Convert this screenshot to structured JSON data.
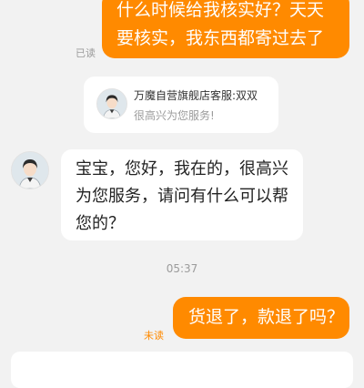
{
  "messages": {
    "outgoing_1": "什么时候给我核实好？天天要核实，我东西都寄过去了",
    "outgoing_1_status": "已读",
    "agent_card": {
      "name": "万魔自营旗舰店客服:双双",
      "subtitle": "很高兴为您服务!"
    },
    "incoming_1": "宝宝，您好，我在的，很高兴为您服务，请问有什么可以帮您的？",
    "timestamp": "05:37",
    "outgoing_2": "货退了，款退了吗？",
    "outgoing_2_status": "未读"
  },
  "colors": {
    "accent": "#ff8a00",
    "background": "#f2f2f2"
  },
  "icons": {
    "agent_avatar": "agent-avatar"
  }
}
